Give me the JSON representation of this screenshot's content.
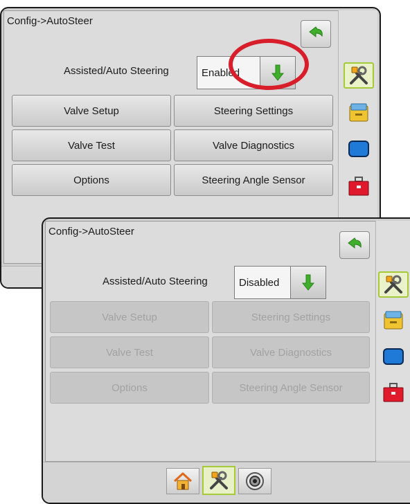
{
  "back_panel": {
    "breadcrumb": "Config->AutoSteer",
    "steering_label": "Assisted/Auto Steering",
    "steering_value": "Enabled",
    "buttons": [
      "Valve Setup",
      "Steering Settings",
      "Valve Test",
      "Valve Diagnostics",
      "Options",
      "Steering Angle Sensor"
    ],
    "buttons_enabled": true
  },
  "front_panel": {
    "breadcrumb": "Config->AutoSteer",
    "steering_label": "Assisted/Auto Steering",
    "steering_value": "Disabled",
    "buttons": [
      "Valve Setup",
      "Steering Settings",
      "Valve Test",
      "Valve Diagnostics",
      "Options",
      "Steering Angle Sensor"
    ],
    "buttons_enabled": false
  },
  "side_tabs": [
    "tools-icon",
    "console-icon",
    "display-icon",
    "toolbox-icon"
  ],
  "bottom_nav": [
    "home-icon",
    "tools-icon",
    "guidance-icon"
  ],
  "colors": {
    "accent_green": "#3fae2a",
    "highlight_red": "#d81e2a",
    "back_arrow": "#3fae2a",
    "toolbox_red": "#e0192c",
    "display_blue": "#1e7ad6"
  }
}
